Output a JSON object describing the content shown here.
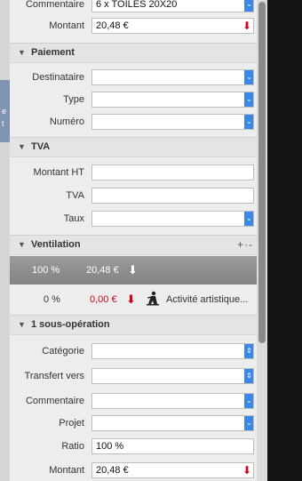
{
  "top": {
    "commentaire": {
      "label": "Commentaire",
      "value": "6 x TOILES 20X20"
    },
    "montant": {
      "label": "Montant",
      "value": "20,48 €"
    }
  },
  "paiement": {
    "title": "Paiement",
    "destinataire": {
      "label": "Destinataire",
      "value": ""
    },
    "type": {
      "label": "Type",
      "value": ""
    },
    "numero": {
      "label": "Numéro",
      "value": ""
    }
  },
  "tva": {
    "title": "TVA",
    "montant_ht": {
      "label": "Montant HT",
      "value": ""
    },
    "tva": {
      "label": "TVA",
      "value": ""
    },
    "taux": {
      "label": "Taux",
      "value": ""
    }
  },
  "ventilation": {
    "title": "Ventilation",
    "tools": "+·-",
    "total": {
      "pct": "100 %",
      "amount": "20,48 €"
    },
    "line": {
      "pct": "0 %",
      "amount": "0,00 €",
      "category": "Activité artistique..."
    }
  },
  "sous_operation": {
    "title": "1 sous-opération",
    "categorie": {
      "label": "Catégorie",
      "value": ""
    },
    "transfert": {
      "label": "Transfert vers",
      "value": ""
    },
    "commentaire": {
      "label": "Commentaire",
      "value": ""
    },
    "projet": {
      "label": "Projet",
      "value": ""
    },
    "ratio": {
      "label": "Ratio",
      "value": "100 %"
    },
    "montant": {
      "label": "Montant",
      "value": "20,48 €"
    }
  },
  "side": {
    "lines": [
      "e",
      "t"
    ]
  },
  "colors": {
    "accent": "#3b88e8",
    "negative": "#d0021b",
    "ventilation_bar": "#8f8f8f"
  },
  "icons": {
    "dropdown": "chevron-down-icon",
    "stepper": "up-down-chevron-icon",
    "arrow": "down-arrow-icon",
    "category": "artist-icon"
  }
}
